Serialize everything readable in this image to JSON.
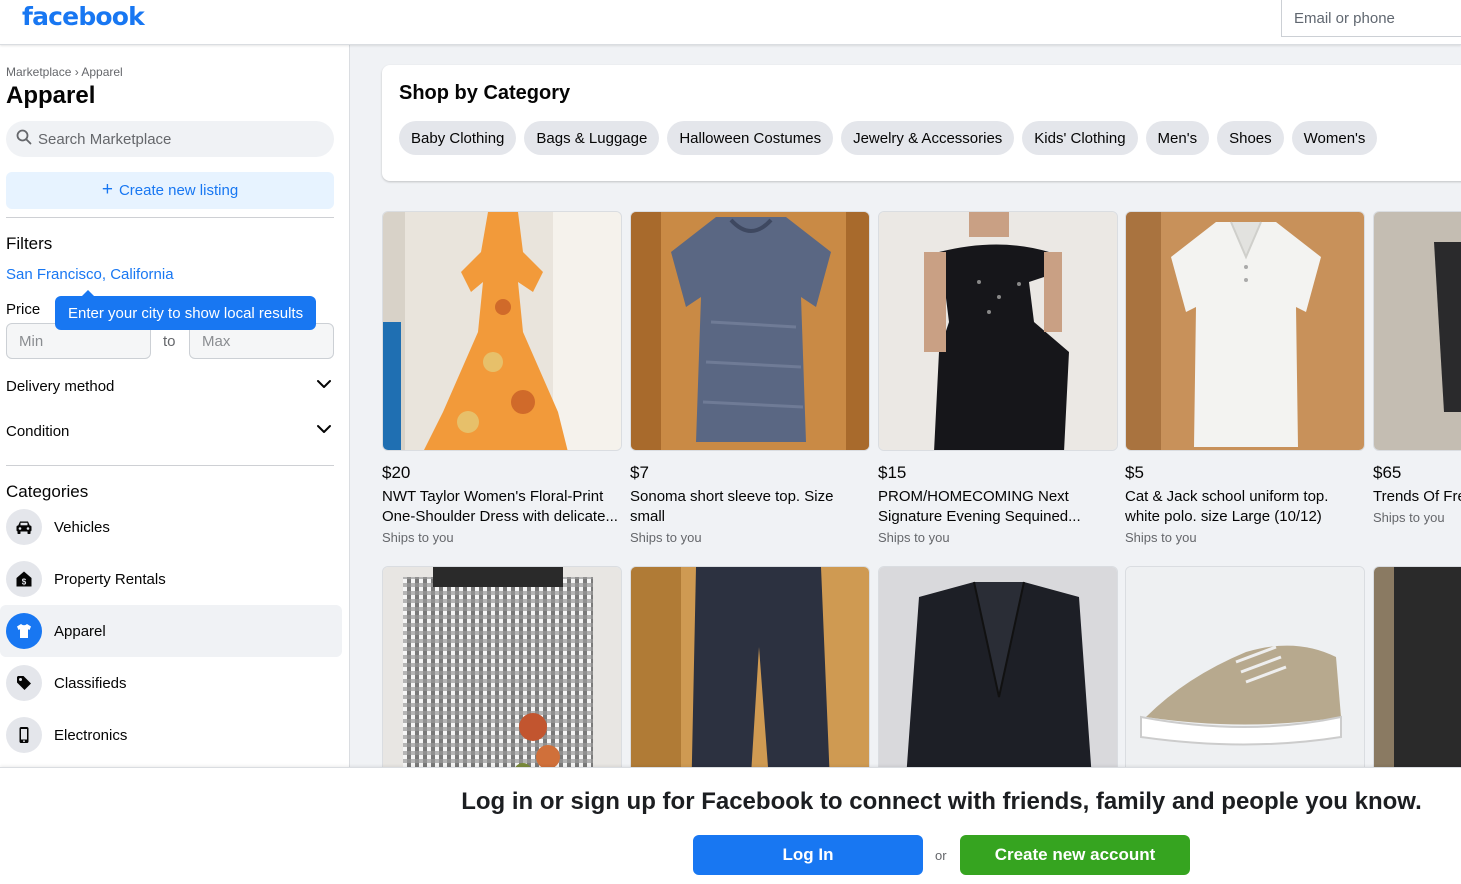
{
  "header": {
    "logo_text": "facebook",
    "email_placeholder": "Email or phone"
  },
  "sidebar": {
    "breadcrumb": "Marketplace › Apparel",
    "title": "Apparel",
    "search_placeholder": "Search Marketplace",
    "create_listing_label": "Create new listing",
    "filters_heading": "Filters",
    "location": "San Francisco, California",
    "price_label": "Price",
    "tooltip": "Enter your city to show local results",
    "price_min_placeholder": "Min",
    "price_to": "to",
    "price_max_placeholder": "Max",
    "delivery_method": "Delivery method",
    "condition": "Condition",
    "categories_heading": "Categories",
    "categories": [
      {
        "label": "Vehicles",
        "icon": "car-icon"
      },
      {
        "label": "Property Rentals",
        "icon": "house-icon"
      },
      {
        "label": "Apparel",
        "icon": "shirt-icon",
        "active": true
      },
      {
        "label": "Classifieds",
        "icon": "tag-icon"
      },
      {
        "label": "Electronics",
        "icon": "phone-icon"
      }
    ]
  },
  "shop_by_category": {
    "title": "Shop by Category",
    "chips": [
      "Baby Clothing",
      "Bags & Luggage",
      "Halloween Costumes",
      "Jewelry & Accessories",
      "Kids' Clothing",
      "Men's",
      "Shoes",
      "Women's"
    ]
  },
  "listings": [
    {
      "price": "$20",
      "title": "NWT Taylor Women's Floral-Print One-Shoulder Dress with delicate...",
      "ships": "Ships to you"
    },
    {
      "price": "$7",
      "title": "Sonoma short sleeve top. Size small",
      "ships": "Ships to you"
    },
    {
      "price": "$15",
      "title": "PROM/HOMECOMING Next Signature Evening Sequined...",
      "ships": "Ships to you"
    },
    {
      "price": "$5",
      "title": "Cat & Jack school uniform top. white polo. size Large (10/12)",
      "ships": "Ships to you"
    },
    {
      "price": "$65",
      "title": "Trends Of Fre Pants XXL Me",
      "ships": "Ships to you"
    }
  ],
  "colors": {
    "brand_blue": "#1877f2",
    "create_green": "#36a420",
    "page_bg": "#f0f2f5"
  },
  "banner": {
    "text": "Log in or sign up for Facebook to connect with friends, family and people you know.",
    "login_label": "Log In",
    "or_text": "or",
    "create_label": "Create new account"
  }
}
